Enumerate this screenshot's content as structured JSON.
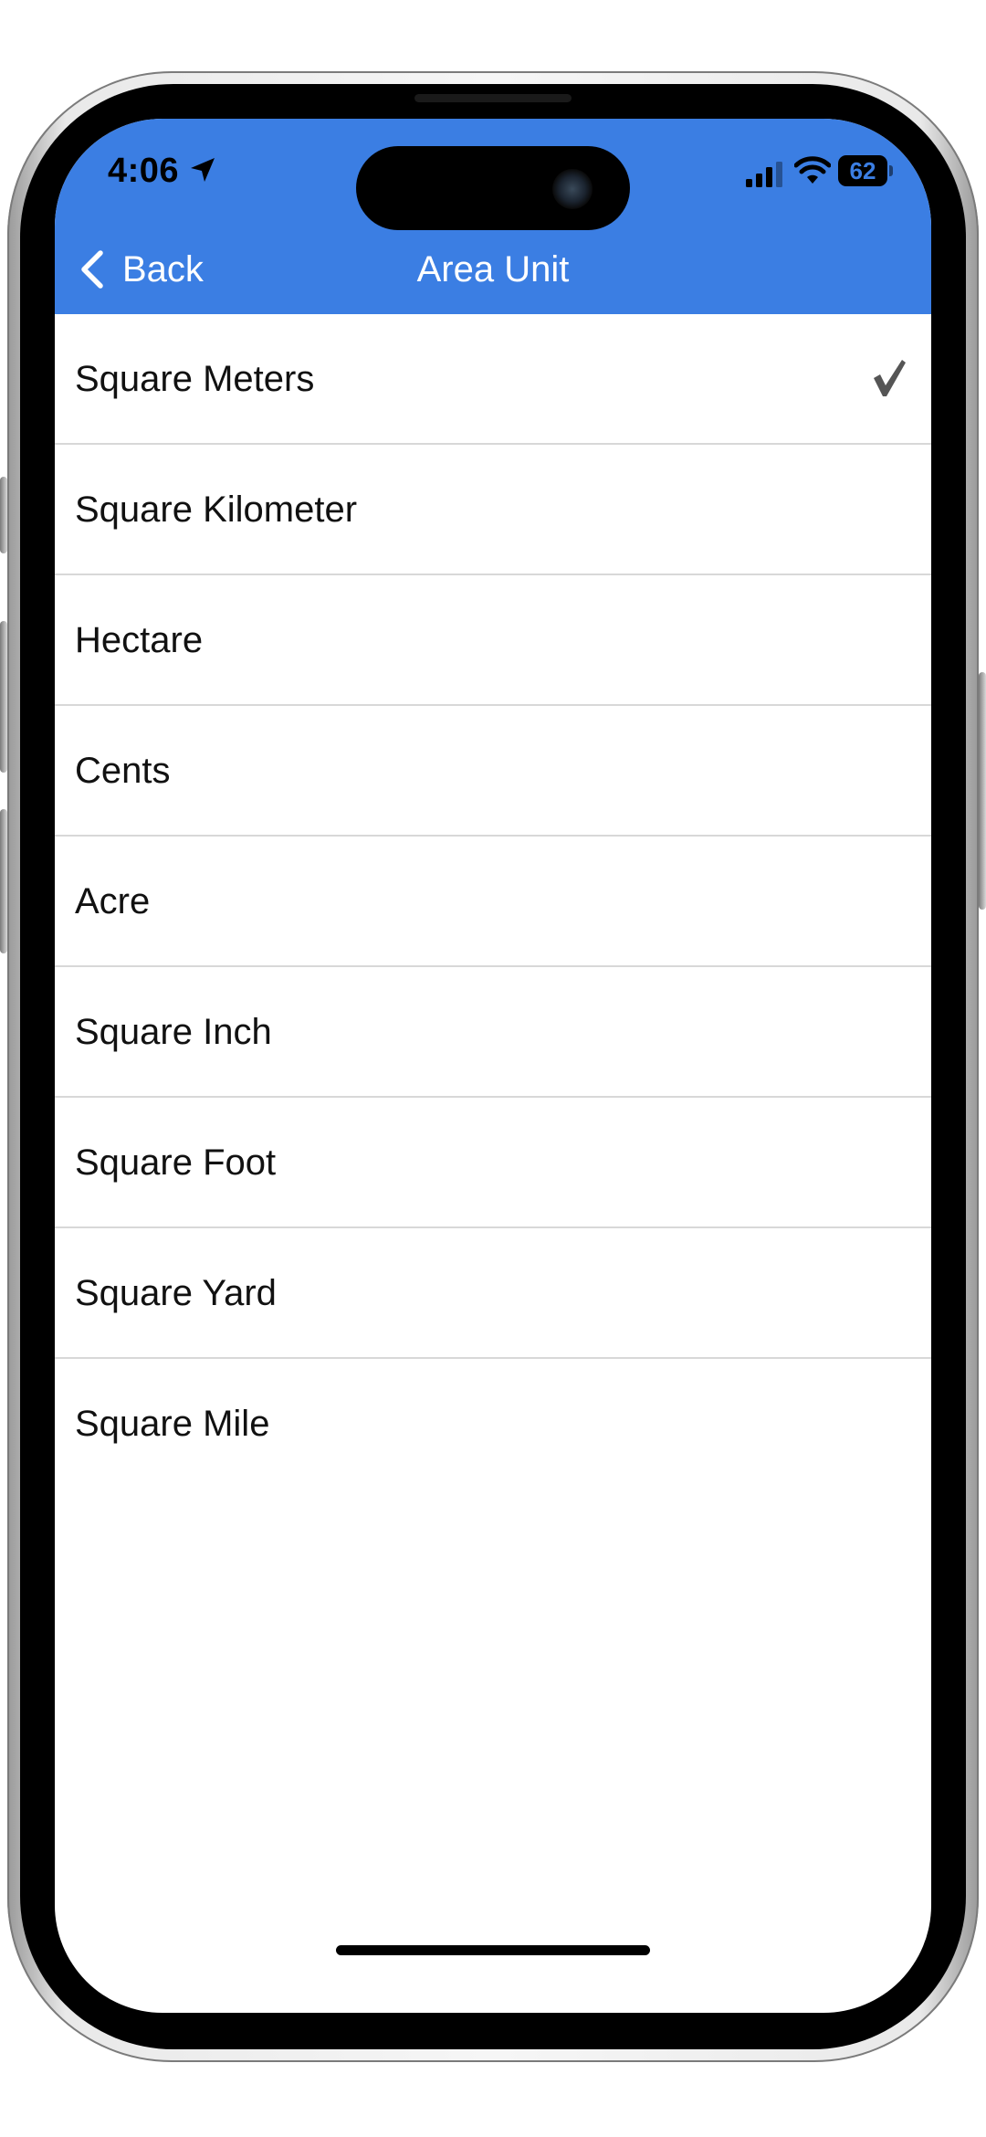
{
  "status_bar": {
    "time": "4:06",
    "battery": "62"
  },
  "nav": {
    "back_label": "Back",
    "title": "Area Unit"
  },
  "units": [
    {
      "label": "Square Meters",
      "selected": true
    },
    {
      "label": "Square Kilometer",
      "selected": false
    },
    {
      "label": "Hectare",
      "selected": false
    },
    {
      "label": "Cents",
      "selected": false
    },
    {
      "label": "Acre",
      "selected": false
    },
    {
      "label": "Square Inch",
      "selected": false
    },
    {
      "label": "Square Foot",
      "selected": false
    },
    {
      "label": "Square Yard",
      "selected": false
    },
    {
      "label": "Square Mile",
      "selected": false
    }
  ],
  "colors": {
    "accent": "#3b7ee3",
    "separator": "#d8d8d8",
    "checkmark": "#555555"
  }
}
